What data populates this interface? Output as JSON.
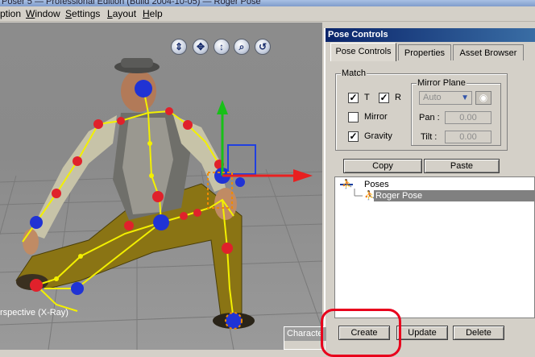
{
  "window": {
    "title": "Poser 5 — Professional Edition (Build 2004-10-05) — Roger Pose"
  },
  "menu": [
    {
      "label": "ption",
      "underline": ""
    },
    {
      "label": "Window",
      "underline": "W"
    },
    {
      "label": "Settings",
      "underline": "S"
    },
    {
      "label": "Layout",
      "underline": "L"
    },
    {
      "label": "Help",
      "underline": "H"
    }
  ],
  "viewport": {
    "camera_label": "rspective (X-Ray)",
    "tools": [
      {
        "name": "move-camera-icon",
        "glyph": "⇕"
      },
      {
        "name": "pan-icon",
        "glyph": "✥"
      },
      {
        "name": "dolly-icon",
        "glyph": "↕"
      },
      {
        "name": "zoom-icon",
        "glyph": "⌕"
      },
      {
        "name": "orbit-icon",
        "glyph": "↺"
      }
    ],
    "colors": {
      "joint": "#e0212b",
      "root_joint": "#2033d4",
      "bone": "#f3f000",
      "gizmo_x": "#e82020",
      "gizmo_y": "#18c018"
    }
  },
  "pose_controls": {
    "title": "Pose Controls",
    "tabs": [
      "Pose Controls",
      "Properties",
      "Asset Browser"
    ],
    "active_tab": 0,
    "match": {
      "label": "Match",
      "t_label": "T",
      "t_checked": true,
      "r_label": "R",
      "r_checked": true,
      "mirror_label": "Mirror",
      "mirror_checked": false,
      "gravity_label": "Gravity",
      "gravity_checked": true
    },
    "mirror_plane": {
      "label": "Mirror Plane",
      "mode": "Auto",
      "pan_label": "Pan :",
      "pan_value": "0.00",
      "tilt_label": "Tilt :",
      "tilt_value": "0.00"
    },
    "copy_label": "Copy",
    "paste_label": "Paste",
    "tree": {
      "root": "Poses",
      "items": [
        "Roger Pose"
      ],
      "selected": 0
    },
    "create_label": "Create",
    "update_label": "Update",
    "delete_label": "Delete"
  },
  "character_panel": {
    "title": "Characte"
  }
}
